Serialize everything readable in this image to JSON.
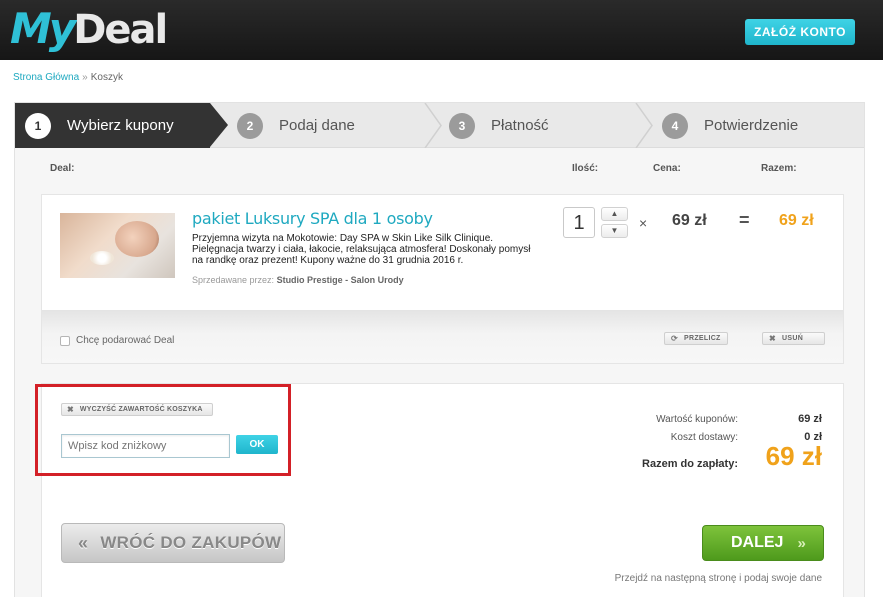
{
  "header": {
    "logo_my": "My",
    "logo_deal": "Deal",
    "create_account_label": "ZAŁÓŻ KONTO"
  },
  "breadcrumb": {
    "home": "Strona Główna",
    "separator": "»",
    "current": "Koszyk"
  },
  "steps": [
    {
      "number": "1",
      "label": "Wybierz kupony",
      "active": true
    },
    {
      "number": "2",
      "label": "Podaj dane",
      "active": false
    },
    {
      "number": "3",
      "label": "Płatność",
      "active": false
    },
    {
      "number": "4",
      "label": "Potwierdzenie",
      "active": false
    }
  ],
  "columns": {
    "deal": "Deal:",
    "quantity": "Ilość:",
    "price": "Cena:",
    "total": "Razem:"
  },
  "item": {
    "title": "pakiet Luksury SPA dla 1 osoby",
    "description": "Przyjemna wizyta na Mokotowie: Day SPA w Skin Like Silk Clinique. Pielęgnacja twarzy i ciała, łakocie, relaksująca atmosfera! Doskonały pomysł na randkę oraz prezent! Kupony ważne do 31 grudnia 2016 r.",
    "seller_prefix": "Sprzedawane przez:",
    "seller_name": "Studio Prestige - Salon Urody",
    "quantity": "1",
    "times": "×",
    "unit_price": "69 zł",
    "equals": "=",
    "total_price": "69 zł",
    "gift_label": "Chcę podarować Deal",
    "recalc_label": "PRZELICZ",
    "remove_label": "USUŃ"
  },
  "coupon": {
    "clear_cart_label": "WYCZYŚĆ ZAWARTOŚĆ KOSZYKA",
    "code_placeholder": "Wpisz kod zniżkowy",
    "ok_label": "OK"
  },
  "summary": {
    "coupons_value_label": "Wartość kuponów:",
    "coupons_value": "69 zł",
    "shipping_label": "Koszt dostawy:",
    "shipping_value": "0 zł",
    "to_pay_label": "Razem do zapłaty:",
    "to_pay_value": "69 zł"
  },
  "actions": {
    "back_label": "WRÓĆ DO ZAKUPÓW",
    "next_label": "DALEJ",
    "next_note": "Przejdź na następną stronę i podaj swoje dane"
  },
  "colors": {
    "accent": "#1fb5cc",
    "price": "#f0a21b",
    "highlight": "#d32027",
    "next_button": "#5ea927"
  }
}
